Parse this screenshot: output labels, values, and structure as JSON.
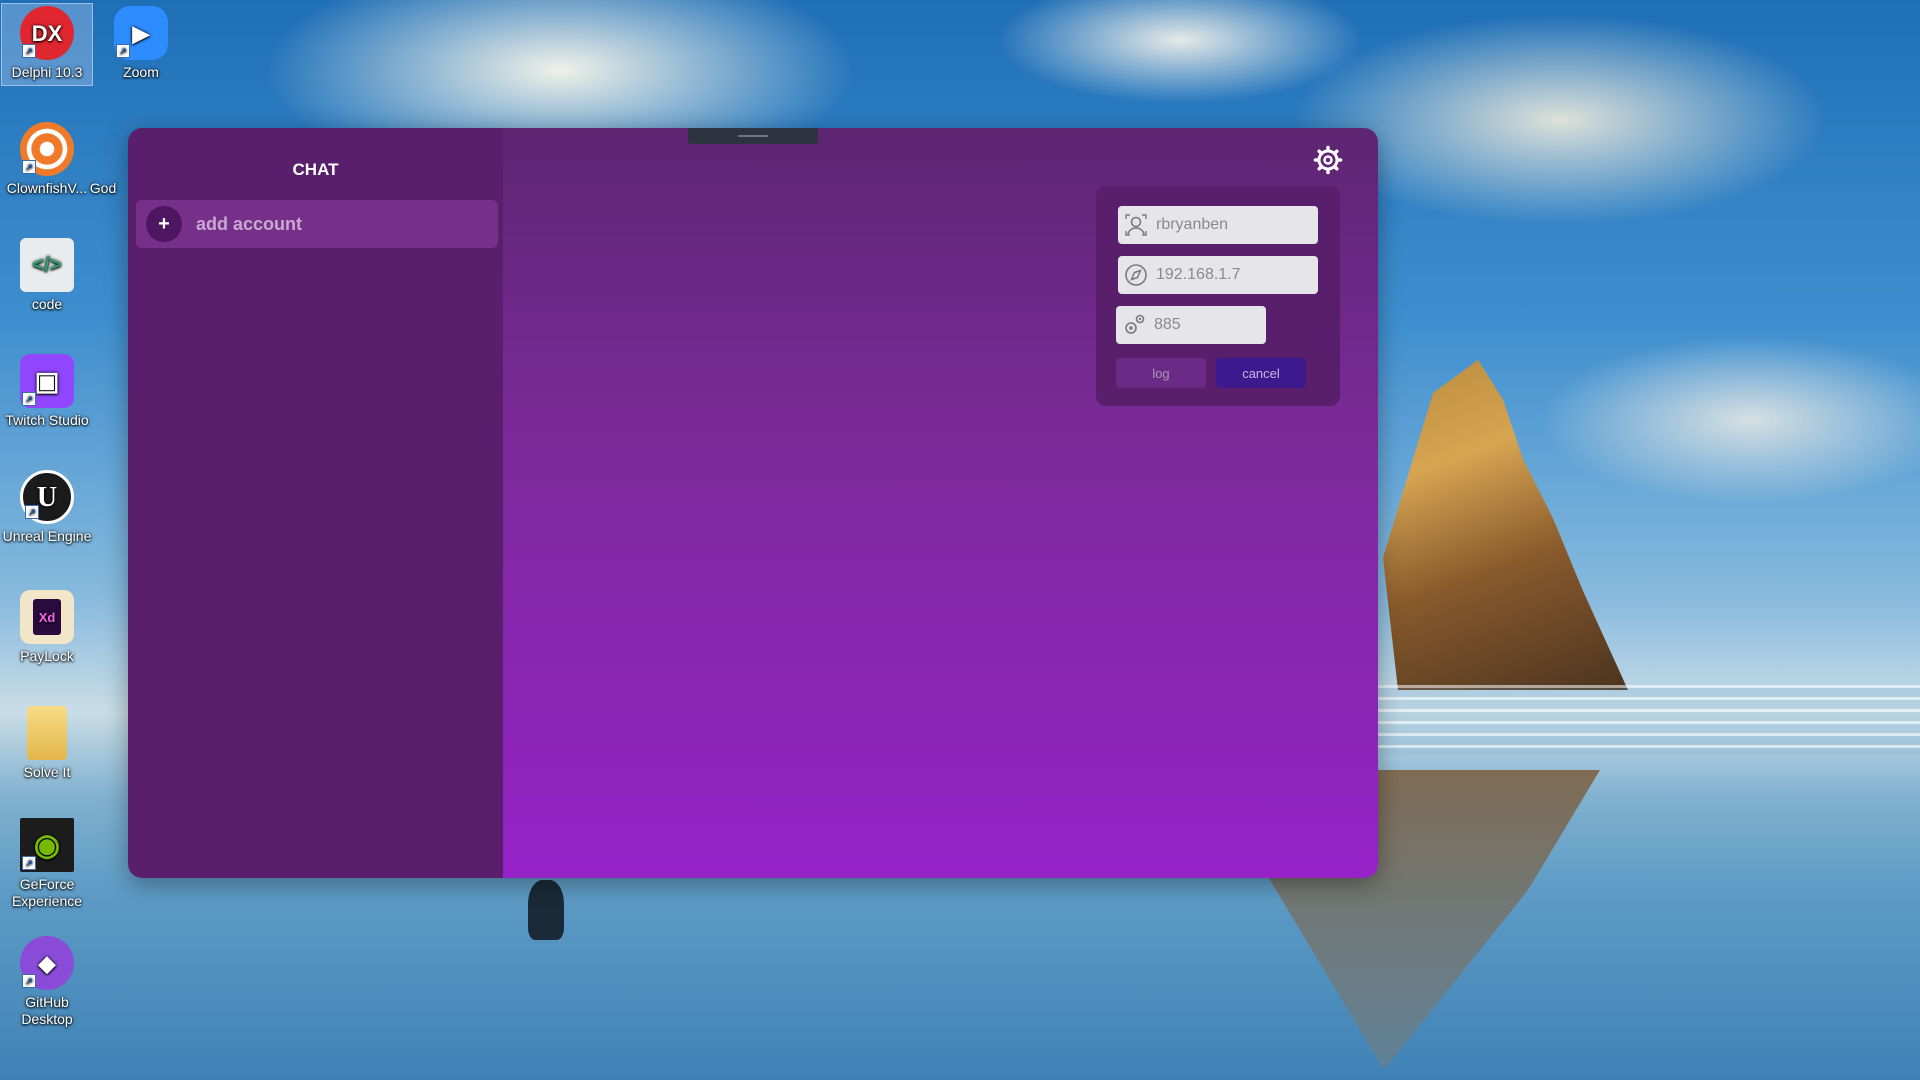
{
  "desktop": {
    "icons": [
      {
        "label": "Delphi 10.3",
        "glyph": "DX",
        "color": "#e0262f",
        "icon": "delphi-icon"
      },
      {
        "label": "Zoom",
        "glyph": "▶",
        "color": "#2d8cff",
        "icon": "zoom-icon"
      },
      {
        "label": "ClownfishV...",
        "glyph": "◎",
        "color": "#f07a2a",
        "icon": "clownfish-icon"
      },
      {
        "label": "God",
        "glyph": "",
        "color": "#4b84c2",
        "icon": "godot-icon"
      },
      {
        "label": "code",
        "glyph": "</>",
        "color": "#e8ecef",
        "icon": "code-icon"
      },
      {
        "label": "Twitch Studio",
        "glyph": "▣",
        "color": "#9146ff",
        "icon": "twitch-icon"
      },
      {
        "label": "Unreal Engine",
        "glyph": "U",
        "color": "#1b1b1b",
        "icon": "unreal-icon"
      },
      {
        "label": "PayLock",
        "glyph": "Xd",
        "color": "#f2e6c8",
        "icon": "paylock-icon"
      },
      {
        "label": "Solve It",
        "glyph": "",
        "color": "#f0cc6a",
        "icon": "folder-icon"
      },
      {
        "label": "GeForce Experience",
        "glyph": "◉",
        "color": "#1c1c1c",
        "icon": "geforce-icon"
      },
      {
        "label": "GitHub Desktop",
        "glyph": "◆",
        "color": "#8a4bd8",
        "icon": "github-icon"
      }
    ]
  },
  "sidebar": {
    "title": "CHAT",
    "add_account_label": "add account",
    "add_icon": "plus-icon"
  },
  "login": {
    "username": {
      "value": "rbryanben",
      "icon": "user-icon"
    },
    "server": {
      "value": "192.168.1.7",
      "icon": "compass-icon"
    },
    "port": {
      "value": "885",
      "icon": "gears-icon"
    },
    "log_label": "log",
    "cancel_label": "cancel"
  },
  "colors": {
    "window_top": "#5d2572",
    "window_bottom": "#9622c8",
    "sidebar": "#5a1f6c",
    "accent": "#3c1a8e"
  }
}
